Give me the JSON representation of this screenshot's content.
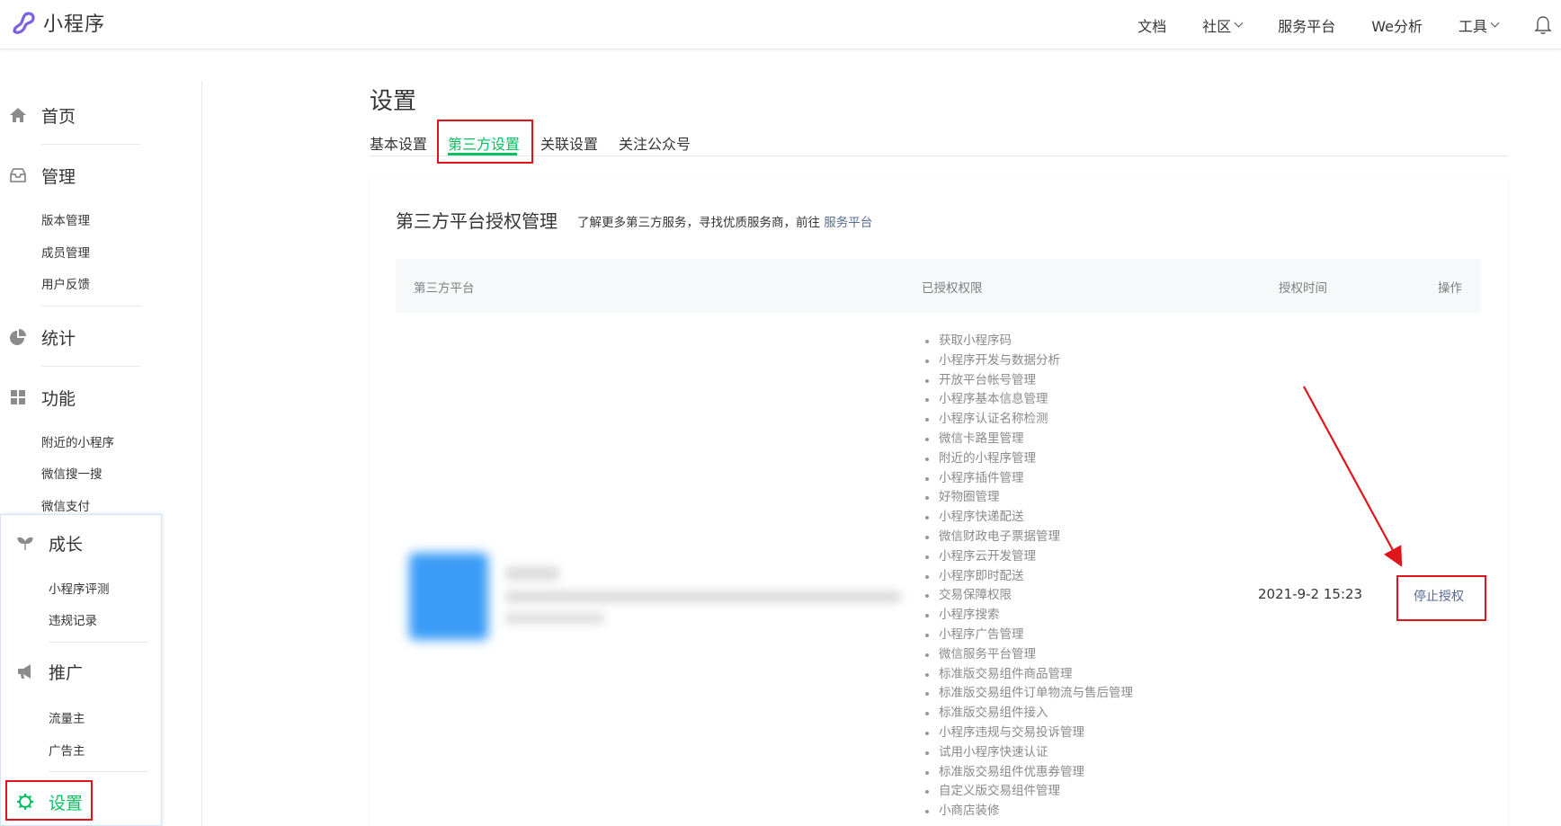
{
  "app": {
    "name": "小程序"
  },
  "topnav": {
    "items": [
      {
        "label": "文档",
        "dropdown": false
      },
      {
        "label": "社区",
        "dropdown": true
      },
      {
        "label": "服务平台",
        "dropdown": false
      },
      {
        "label": "We分析",
        "dropdown": false
      },
      {
        "label": "工具",
        "dropdown": true
      }
    ],
    "bell_icon": "bell-icon"
  },
  "sidebar": {
    "home": {
      "label": "首页",
      "icon": "home-icon"
    },
    "manage": {
      "label": "管理",
      "icon": "inbox-icon",
      "items": [
        "版本管理",
        "成员管理",
        "用户反馈"
      ]
    },
    "stats": {
      "label": "统计",
      "icon": "pie-chart-icon"
    },
    "features": {
      "label": "功能",
      "icon": "grid-icon",
      "items": [
        "附近的小程序",
        "微信搜一搜",
        "微信支付"
      ]
    },
    "growth": {
      "label": "成长",
      "icon": "sprout-icon",
      "items": [
        "小程序评测",
        "违规记录"
      ]
    },
    "promote": {
      "label": "推广",
      "icon": "megaphone-icon",
      "items": [
        "流量主",
        "广告主"
      ]
    },
    "settings": {
      "label": "设置",
      "icon": "gear-icon"
    }
  },
  "page": {
    "title": "设置",
    "tabs": [
      "基本设置",
      "第三方设置",
      "关联设置",
      "关注公众号"
    ],
    "active_tab": "第三方设置"
  },
  "card": {
    "title": "第三方平台授权管理",
    "desc_prefix": "了解更多第三方服务，寻找优质服务商，前往",
    "desc_link": "服务平台"
  },
  "table": {
    "headers": [
      "第三方平台",
      "已授权权限",
      "授权时间",
      "操作"
    ],
    "row": {
      "permissions": [
        "获取小程序码",
        "小程序开发与数据分析",
        "开放平台帐号管理",
        "小程序基本信息管理",
        "小程序认证名称检测",
        "微信卡路里管理",
        "附近的小程序管理",
        "小程序插件管理",
        "好物圈管理",
        "小程序快递配送",
        "微信财政电子票据管理",
        "小程序云开发管理",
        "小程序即时配送",
        "交易保障权限",
        "小程序搜索",
        "小程序广告管理",
        "微信服务平台管理",
        "标准版交易组件商品管理",
        "标准版交易组件订单物流与售后管理",
        "标准版交易组件接入",
        "小程序违规与交易投诉管理",
        "试用小程序快速认证",
        "标准版交易组件优惠券管理",
        "自定义版交易组件管理",
        "小商店装修"
      ],
      "time": "2021-9-2 15:23",
      "action": "停止授权"
    }
  },
  "colors": {
    "accent": "#07c160",
    "link": "#576b95",
    "annotation": "#e0151b"
  }
}
